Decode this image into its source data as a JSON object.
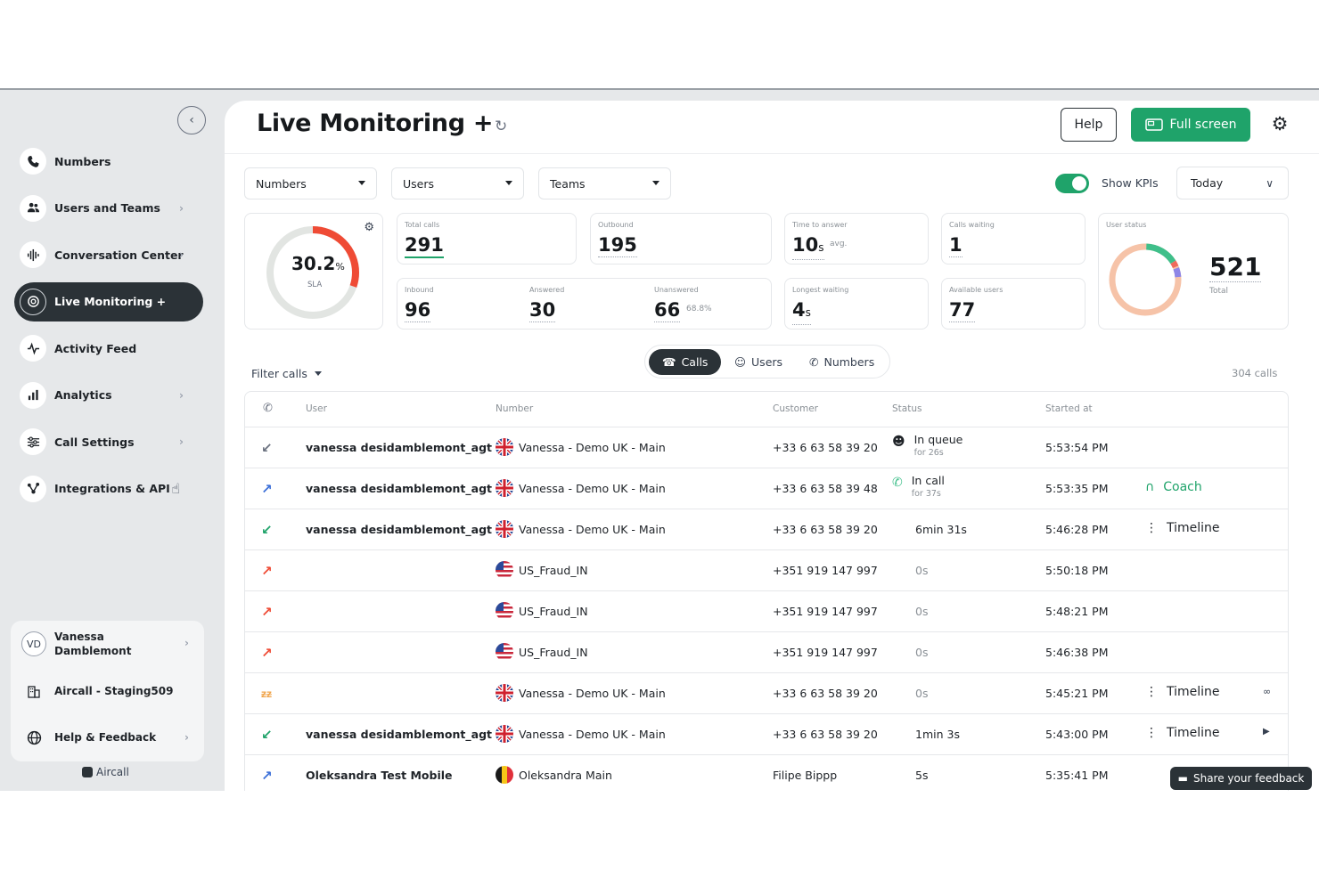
{
  "sidebar": {
    "items": [
      {
        "label": "Numbers",
        "icon": "phone-icon",
        "has_chevron": false
      },
      {
        "label": "Users and Teams",
        "icon": "users-icon",
        "has_chevron": true
      },
      {
        "label": "Conversation Center",
        "icon": "waveform-icon",
        "has_chevron": true
      },
      {
        "label": "Live Monitoring +",
        "icon": "live-monitoring-icon",
        "has_chevron": false,
        "active": true
      },
      {
        "label": "Activity Feed",
        "icon": "activity-pulse-icon",
        "has_chevron": false
      },
      {
        "label": "Analytics",
        "icon": "bar-chart-icon",
        "has_chevron": true
      },
      {
        "label": "Call Settings",
        "icon": "sliders-icon",
        "has_chevron": true
      },
      {
        "label": "Integrations & API",
        "icon": "integrations-icon",
        "has_chevron": false
      }
    ],
    "account": {
      "initials": "VD",
      "name_line1": "Vanessa",
      "name_line2": "Damblemont",
      "company": "Aircall - Staging509",
      "help": "Help & Feedback"
    },
    "brand": "Aircall"
  },
  "header": {
    "title": "Live Monitoring +",
    "help_label": "Help",
    "fullscreen_label": "Full screen"
  },
  "filters": {
    "numbers": "Numbers",
    "users": "Users",
    "teams": "Teams",
    "show_kpis_label": "Show KPIs",
    "show_kpis_on": true,
    "period": "Today"
  },
  "kpis": {
    "sla": {
      "value": "30.2",
      "unit": "%",
      "label": "SLA",
      "fraction": 0.302
    },
    "total_calls": {
      "label": "Total calls",
      "value": "291"
    },
    "outbound": {
      "label": "Outbound",
      "value": "195"
    },
    "time_to_answer": {
      "label": "Time to answer",
      "value": "10",
      "unit": "s",
      "note": "avg."
    },
    "calls_waiting": {
      "label": "Calls waiting",
      "value": "1"
    },
    "inbound": {
      "label": "Inbound",
      "value": "96"
    },
    "answered": {
      "label": "Answered",
      "value": "30"
    },
    "unanswered": {
      "label": "Unanswered",
      "value": "66",
      "note": "68.8%"
    },
    "longest_waiting": {
      "label": "Longest waiting",
      "value": "4",
      "unit": "s"
    },
    "available_users": {
      "label": "Available users",
      "value": "77"
    },
    "user_status": {
      "label": "User status",
      "total": "521",
      "total_label": "Total"
    }
  },
  "tabs": [
    {
      "label": "Calls",
      "icon": "phone-icon",
      "active": true
    },
    {
      "label": "Users",
      "icon": "user-icon",
      "active": false
    },
    {
      "label": "Numbers",
      "icon": "phone-icon",
      "active": false
    }
  ],
  "list": {
    "filter_label": "Filter calls",
    "count": "304 calls",
    "columns": [
      "User",
      "Number",
      "Customer",
      "Status",
      "Started at"
    ],
    "rows": [
      {
        "direction": "inbound",
        "user": "vanessa desidamblemont_agt",
        "flag": "uk",
        "number": "Vanessa - Demo UK - Main",
        "customer": "+33 6 63 58 39 20",
        "status": "In queue",
        "status_sub": "for 26s",
        "status_icon": "queue-icon",
        "started": "5:53:54 PM",
        "action": ""
      },
      {
        "direction": "outbound",
        "user": "vanessa desidamblemont_agt",
        "flag": "uk",
        "number": "Vanessa - Demo UK - Main",
        "customer": "+33 6 63 58 39 48",
        "status": "In call",
        "status_sub": "for 37s",
        "status_icon": "in-call-icon",
        "started": "5:53:35 PM",
        "action": "Coach"
      },
      {
        "direction": "inbound-answered",
        "user": "vanessa desidamblemont_agt",
        "flag": "uk",
        "number": "Vanessa - Demo UK - Main",
        "customer": "+33 6 63 58 39 20",
        "status": "6min 31s",
        "started": "5:46:28 PM",
        "action": "Timeline"
      },
      {
        "direction": "outbound-missed",
        "user": "",
        "flag": "us",
        "number": "US_Fraud_IN",
        "customer": "+351 919 147 997",
        "status": "0s",
        "started": "5:50:18 PM",
        "action": ""
      },
      {
        "direction": "outbound-missed",
        "user": "",
        "flag": "us",
        "number": "US_Fraud_IN",
        "customer": "+351 919 147 997",
        "status": "0s",
        "started": "5:48:21 PM",
        "action": ""
      },
      {
        "direction": "outbound-missed",
        "user": "",
        "flag": "us",
        "number": "US_Fraud_IN",
        "customer": "+351 919 147 997",
        "status": "0s",
        "started": "5:46:38 PM",
        "action": ""
      },
      {
        "direction": "voicemail",
        "user": "",
        "flag": "uk",
        "number": "Vanessa - Demo UK - Main",
        "customer": "+33 6 63 58 39 20",
        "status": "0s",
        "started": "5:45:21 PM",
        "action": "Timeline",
        "end_icon": "voicemail-icon"
      },
      {
        "direction": "inbound-answered",
        "user": "vanessa desidamblemont_agt",
        "flag": "uk",
        "number": "Vanessa - Demo UK - Main",
        "customer": "+33 6 63 58 39 20",
        "status": "1min 3s",
        "started": "5:43:00 PM",
        "action": "Timeline",
        "end_icon": "play-icon"
      },
      {
        "direction": "outbound",
        "user": "Oleksandra Test Mobile",
        "flag": "be",
        "number": "Oleksandra Main",
        "customer": "Filipe Bippp",
        "status": "5s",
        "started": "5:35:41 PM",
        "action": ""
      }
    ]
  },
  "feedback_label": "Share your feedback",
  "colors": {
    "accent": "#1fa36a",
    "dark": "#2b3237",
    "sla_arc": "#ef4b35",
    "status_green": "#3fbf8a",
    "status_peach": "#f6c3a8",
    "status_purple": "#8e86e6",
    "status_coral": "#ef6b5b"
  }
}
